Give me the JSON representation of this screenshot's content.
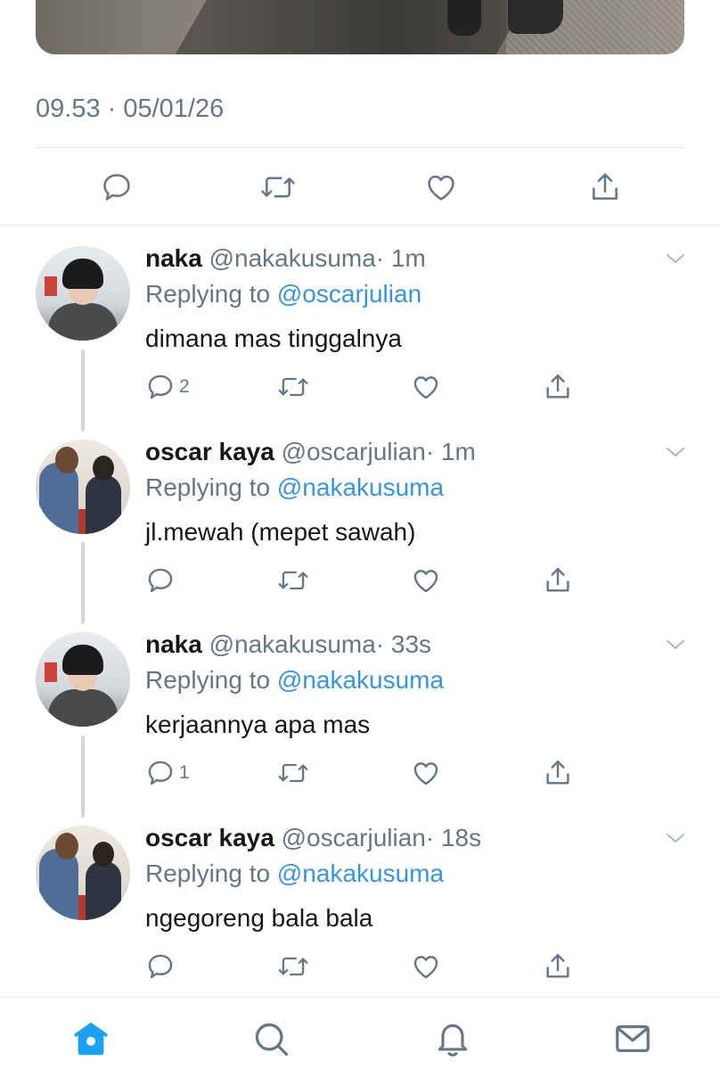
{
  "tweet": {
    "timestamp": "09.53 · 05/01/26"
  },
  "replies": [
    {
      "name": "naka",
      "handle": "@nakakusuma",
      "time": "· 1m",
      "replying_prefix": "Replying to",
      "replying_to": "@oscarjulian",
      "text": "dimana mas tinggalnya",
      "reply_count": "2",
      "avatar": "naka"
    },
    {
      "name": "oscar kaya",
      "handle": "@oscarjulian",
      "time": "· 1m",
      "replying_prefix": "Replying to",
      "replying_to": "@nakakusuma",
      "text": "jl.mewah (mepet sawah)",
      "reply_count": "",
      "avatar": "oscar"
    },
    {
      "name": "naka",
      "handle": "@nakakusuma",
      "time": "· 33s",
      "replying_prefix": "Replying to",
      "replying_to": "@nakakusuma",
      "text": "kerjaannya apa mas",
      "reply_count": "1",
      "avatar": "naka"
    },
    {
      "name": "oscar kaya",
      "handle": "@oscarjulian",
      "time": "· 18s",
      "replying_prefix": "Replying to",
      "replying_to": "@nakakusuma",
      "text": "ngegoreng bala bala",
      "reply_count": "",
      "avatar": "oscar"
    }
  ],
  "icons": {
    "reply": "reply-icon",
    "retweet": "retweet-icon",
    "like": "heart-icon",
    "share": "share-icon",
    "more": "chevron-down-icon",
    "home": "home-icon",
    "search": "search-icon",
    "notifications": "bell-icon",
    "messages": "mail-icon"
  },
  "colors": {
    "accent": "#1da1f2",
    "mention": "#3b94d9",
    "secondary_text": "#657786",
    "divider": "#e1e8ed"
  }
}
